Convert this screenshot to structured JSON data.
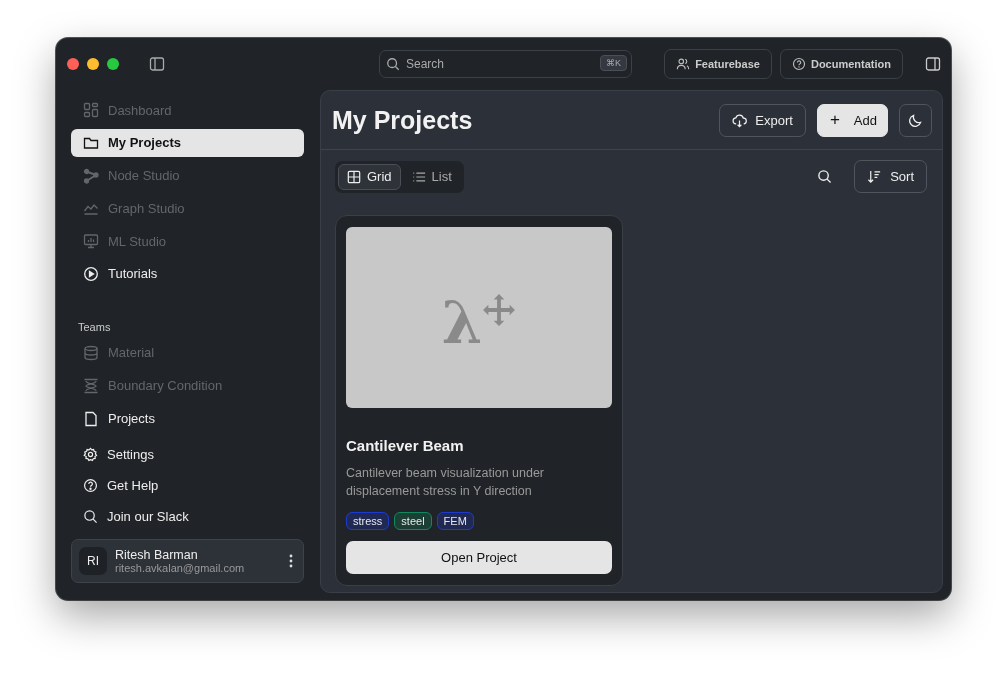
{
  "titlebar": {
    "search": {
      "placeholder": "Search",
      "shortcut": "⌘K"
    },
    "buttons": [
      {
        "label": "Featurebase",
        "kind": "people"
      },
      {
        "label": "Documentation",
        "kind": "help"
      }
    ]
  },
  "sidebar": {
    "items": [
      {
        "label": "Dashboard",
        "kind": "dashboard",
        "selected": false,
        "disabled": true
      },
      {
        "label": "My Projects",
        "kind": "folder",
        "selected": true,
        "disabled": false
      },
      {
        "label": "Node Studio",
        "kind": "nodes",
        "selected": false,
        "disabled": true
      },
      {
        "label": "Graph Studio",
        "kind": "graph",
        "selected": false,
        "disabled": true
      },
      {
        "label": "ML Studio",
        "kind": "monitor",
        "selected": false,
        "disabled": true
      },
      {
        "label": "Tutorials",
        "kind": "play",
        "selected": false,
        "disabled": false
      }
    ],
    "section_title": "Teams",
    "team_items": [
      {
        "label": "Material",
        "kind": "database",
        "disabled": true
      },
      {
        "label": "Boundary Condition",
        "kind": "boundary",
        "disabled": true
      },
      {
        "label": "Projects",
        "kind": "file",
        "disabled": false
      }
    ],
    "footer_items": [
      {
        "label": "Settings",
        "kind": "gear"
      },
      {
        "label": "Get Help",
        "kind": "help"
      },
      {
        "label": "Join our Slack",
        "kind": "search"
      }
    ],
    "user": {
      "initials": "RI",
      "name": "Ritesh Barman",
      "email": "ritesh.avkalan@gmail.com"
    }
  },
  "main": {
    "title": "My Projects",
    "export": "Export",
    "add": "Add",
    "add_icon": "+",
    "view_tabs": [
      {
        "label": "Grid",
        "kind": "grid",
        "selected": true
      },
      {
        "label": "List",
        "kind": "list",
        "selected": false
      }
    ],
    "sort": "Sort",
    "projects": [
      {
        "logo": "λ",
        "title": "Cantilever Beam",
        "description": "Cantilever beam visualization under displacement stress in Y direction",
        "tags": [
          {
            "label": "stress",
            "color": "#1d3bd1"
          },
          {
            "label": "steel",
            "color": "#0f8a5f"
          },
          {
            "label": "FEM",
            "color": "#1d3bd1"
          }
        ],
        "button": "Open Project"
      }
    ]
  }
}
